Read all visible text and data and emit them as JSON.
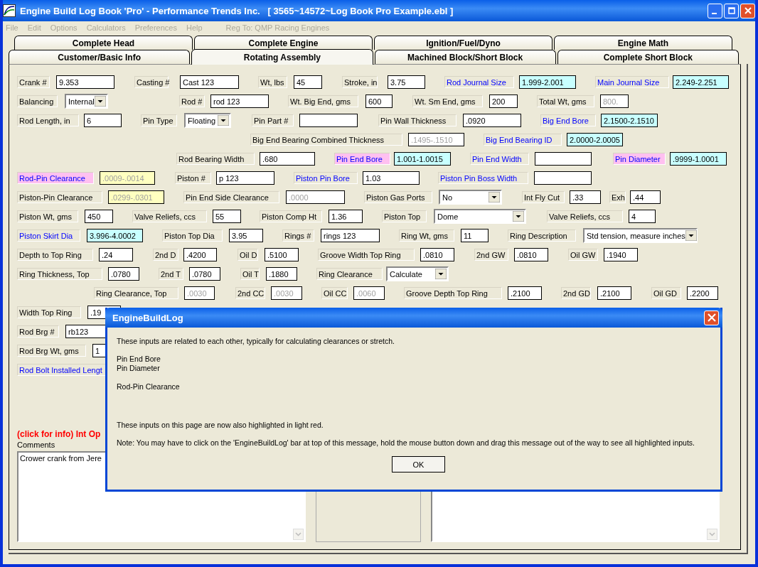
{
  "window": {
    "title": "Engine Build Log Book 'Pro' - Performance Trends Inc.   [ 3565~14572~Log Book Pro Example.ebl ]"
  },
  "menu": [
    {
      "label": "File",
      "disabled": true
    },
    {
      "label": "Edit",
      "disabled": true
    },
    {
      "label": "Options",
      "disabled": true
    },
    {
      "label": "Calculators",
      "disabled": true
    },
    {
      "label": "Preferences",
      "disabled": true
    },
    {
      "label": "Help",
      "disabled": true
    }
  ],
  "registration": "Reg To: QMP Racing Engines",
  "tabs_back": [
    {
      "label": "Complete Head",
      "selected": false
    },
    {
      "label": "Complete Engine",
      "selected": false
    },
    {
      "label": "Ignition/Fuel/Dyno",
      "selected": false
    },
    {
      "label": "Engine Math",
      "selected": false
    }
  ],
  "tabs_front": [
    {
      "label": "Customer/Basic Info",
      "selected": false
    },
    {
      "label": "Rotating Assembly",
      "selected": true
    },
    {
      "label": "Machined Block/Short Block",
      "selected": false
    },
    {
      "label": "Complete Short Block",
      "selected": false
    }
  ],
  "form_rows": [
    [
      {
        "label": {
          "text": "Crank #",
          "kind": "plain"
        },
        "field": {
          "value": "9.353",
          "kind": "text",
          "disabled": false
        }
      },
      {
        "label": {
          "text": "Casting #",
          "kind": "plain"
        },
        "field": {
          "value": "Cast 123",
          "kind": "text",
          "disabled": false
        }
      },
      {
        "label": {
          "text": "Wt, lbs",
          "kind": "plain"
        },
        "field": {
          "value": "45",
          "kind": "text",
          "disabled": false
        }
      },
      {
        "label": {
          "text": "Stroke, in",
          "kind": "plain"
        },
        "field": {
          "value": "3.75",
          "kind": "text",
          "disabled": false
        }
      },
      {
        "label": {
          "text": "Rod Journal Size",
          "kind": "linked"
        },
        "field": {
          "value": "1.999-2.001",
          "kind": "spec",
          "disabled": false
        }
      },
      {
        "label": {
          "text": "Main Journal Size",
          "kind": "linked"
        },
        "field": {
          "value": "2.249-2.251",
          "kind": "spec",
          "disabled": false
        }
      }
    ],
    [
      {
        "label": {
          "text": "Balancing",
          "kind": "plain"
        },
        "field": {
          "value": "Internal",
          "kind": "select"
        }
      },
      {
        "label": {
          "text": "Rod #",
          "kind": "plain"
        },
        "field": {
          "value": "rod 123",
          "kind": "text",
          "disabled": false
        }
      },
      {
        "label": {
          "text": "Wt. Big End, gms",
          "kind": "plain"
        },
        "field": {
          "value": "600",
          "kind": "text",
          "disabled": false
        }
      },
      {
        "label": {
          "text": "Wt. Sm End, gms",
          "kind": "plain"
        },
        "field": {
          "value": "200",
          "kind": "text",
          "disabled": false
        }
      },
      {
        "label": {
          "text": "Total Wt, gms",
          "kind": "plain"
        },
        "field": {
          "value": "800.",
          "kind": "text",
          "disabled": true
        }
      }
    ],
    [
      {
        "label": {
          "text": "Rod Length, in",
          "kind": "plain"
        },
        "field": {
          "value": "6",
          "kind": "text",
          "disabled": false
        }
      },
      {
        "label": {
          "text": "Pin Type",
          "kind": "plain"
        },
        "field": {
          "value": "Floating",
          "kind": "select"
        }
      },
      {
        "label": {
          "text": "Pin Part #",
          "kind": "plain"
        },
        "field": {
          "kind": "text"
        }
      },
      {
        "label": {
          "text": "Pin Wall Thickness",
          "kind": "plain"
        },
        "field": {
          "value": ".0920",
          "kind": "text",
          "disabled": false
        }
      },
      {
        "label": {
          "text": "Big End Bore",
          "kind": "linked"
        },
        "field": {
          "value": "2.1500-2.1510",
          "kind": "spec",
          "disabled": false
        }
      }
    ],
    [
      {
        "label": {
          "text": "Big End Bearing Combined Thickness",
          "kind": "plain"
        },
        "field": {
          "value": ".1495-.1510",
          "kind": "text",
          "disabled": true
        }
      },
      {
        "label": {
          "text": "Big End Bearing ID",
          "kind": "linked"
        },
        "field": {
          "value": "2.0000-2.0005",
          "kind": "spec",
          "disabled": false
        }
      }
    ],
    [
      {
        "label": {
          "text": "Rod Bearing Width",
          "kind": "plain"
        },
        "field": {
          "value": ".680",
          "kind": "text",
          "disabled": false
        }
      },
      {
        "label": {
          "text": "Pin End Bore",
          "kind": "highlighted"
        },
        "field": {
          "value": "1.001-1.0015",
          "kind": "spec",
          "disabled": false
        }
      },
      {
        "label": {
          "text": "Pin End Width",
          "kind": "linked"
        },
        "field": {
          "kind": "text"
        }
      },
      {
        "label": {
          "text": "Pin Diameter",
          "kind": "highlighted"
        },
        "field": {
          "value": ".9999-1.0001",
          "kind": "spec",
          "disabled": false
        }
      }
    ],
    [
      {
        "label": {
          "text": "Rod-Pin Clearance",
          "kind": "highlighted"
        },
        "field": {
          "value": ".0009-.0014",
          "kind": "calc",
          "disabled": true
        }
      },
      {
        "label": {
          "text": "Piston #",
          "kind": "plain"
        },
        "field": {
          "value": "p 123",
          "kind": "text",
          "disabled": false
        }
      },
      {
        "label": {
          "text": "Piston Pin Bore",
          "kind": "linked"
        },
        "field": {
          "value": "1.03",
          "kind": "text",
          "disabled": false
        }
      },
      {
        "label": {
          "text": "Piston Pin Boss Width",
          "kind": "linked"
        },
        "field": {
          "kind": "text"
        }
      }
    ],
    [
      {
        "label": {
          "text": "Piston-Pin Clearance",
          "kind": "plain"
        },
        "field": {
          "value": ".0299-.0301",
          "kind": "calc",
          "disabled": true
        }
      },
      {
        "label": {
          "text": "Pin End Side Clearance",
          "kind": "plain"
        },
        "field": {
          "value": ".0000",
          "kind": "text",
          "disabled": true
        }
      },
      {
        "label": {
          "text": "Piston Gas Ports",
          "kind": "plain"
        },
        "field": {
          "value": "No",
          "kind": "select"
        }
      },
      {
        "label": {
          "text": "Int Fly Cut",
          "kind": "plain"
        },
        "field": {
          "value": ".33",
          "kind": "text",
          "disabled": false
        }
      },
      {
        "label": {
          "text": "Exh",
          "kind": "plain"
        },
        "field": {
          "value": ".44",
          "kind": "text",
          "disabled": false
        }
      }
    ],
    [
      {
        "label": {
          "text": "Piston Wt, gms",
          "kind": "plain"
        },
        "field": {
          "value": "450",
          "kind": "text",
          "disabled": false
        }
      },
      {
        "label": {
          "text": "Valve Reliefs, ccs",
          "kind": "plain"
        },
        "field": {
          "value": "55",
          "kind": "text",
          "disabled": false
        }
      },
      {
        "label": {
          "text": "Piston Comp Ht",
          "kind": "plain"
        },
        "field": {
          "value": "1.36",
          "kind": "text",
          "disabled": false
        }
      },
      {
        "label": {
          "text": "Piston Top",
          "kind": "plain"
        },
        "field": {
          "value": "Dome",
          "kind": "select"
        }
      },
      {
        "label": {
          "text": "Valve Reliefs, ccs",
          "kind": "plain"
        },
        "field": {
          "value": "4",
          "kind": "text",
          "disabled": false
        }
      }
    ],
    [
      {
        "label": {
          "text": "Piston Skirt Dia",
          "kind": "linked"
        },
        "field": {
          "value": "3.996-4.0002",
          "kind": "spec",
          "disabled": false
        }
      },
      {
        "label": {
          "text": "Piston Top Dia",
          "kind": "plain"
        },
        "field": {
          "value": "3.95",
          "kind": "text",
          "disabled": false
        }
      },
      {
        "label": {
          "text": "Rings #",
          "kind": "plain"
        },
        "field": {
          "value": "rings 123",
          "kind": "text",
          "disabled": false
        }
      },
      {
        "label": {
          "text": "Ring Wt, gms",
          "kind": "plain"
        },
        "field": {
          "value": "11",
          "kind": "text",
          "disabled": false
        }
      },
      {
        "label": {
          "text": "Ring Description",
          "kind": "plain"
        },
        "field": {
          "value": "Std tension, measure inches",
          "kind": "select"
        }
      }
    ],
    [
      {
        "label": {
          "text": "Depth to Top Ring",
          "kind": "plain"
        },
        "field": {
          "value": ".24",
          "kind": "text",
          "disabled": false
        }
      },
      {
        "label": {
          "text": "2nd D",
          "kind": "plain"
        },
        "field": {
          "value": ".4200",
          "kind": "text",
          "disabled": false
        }
      },
      {
        "label": {
          "text": "Oil D",
          "kind": "plain"
        },
        "field": {
          "value": ".5100",
          "kind": "text",
          "disabled": false
        }
      },
      {
        "label": {
          "text": "Groove Width Top Ring",
          "kind": "plain"
        },
        "field": {
          "value": ".0810",
          "kind": "text",
          "disabled": false
        }
      },
      {
        "label": {
          "text": "2nd GW",
          "kind": "plain"
        },
        "field": {
          "value": ".0810",
          "kind": "text",
          "disabled": false
        }
      },
      {
        "label": {
          "text": "Oil GW",
          "kind": "plain"
        },
        "field": {
          "value": ".1940",
          "kind": "text",
          "disabled": false
        }
      }
    ],
    [
      {
        "label": {
          "text": "Ring Thickness, Top",
          "kind": "plain"
        },
        "field": {
          "value": ".0780",
          "kind": "text",
          "disabled": false
        }
      },
      {
        "label": {
          "text": "2nd T",
          "kind": "plain"
        },
        "field": {
          "value": ".0780",
          "kind": "text",
          "disabled": false
        }
      },
      {
        "label": {
          "text": "Oil T",
          "kind": "plain"
        },
        "field": {
          "value": ".1880",
          "kind": "text",
          "disabled": false
        }
      },
      {
        "label": {
          "text": "Ring Clearance",
          "kind": "plain"
        },
        "field": {
          "value": "Calculate",
          "kind": "select"
        }
      }
    ],
    [
      {
        "label": {
          "text": "Ring Clearance, Top",
          "kind": "plain"
        },
        "field": {
          "value": ".0030",
          "kind": "text",
          "disabled": true
        }
      },
      {
        "label": {
          "text": "2nd CC",
          "kind": "plain"
        },
        "field": {
          "value": ".0030",
          "kind": "text",
          "disabled": true
        }
      },
      {
        "label": {
          "text": "Oil CC",
          "kind": "plain"
        },
        "field": {
          "value": ".0060",
          "kind": "text",
          "disabled": true
        }
      },
      {
        "label": {
          "text": "Groove Depth Top Ring",
          "kind": "plain"
        },
        "field": {
          "value": ".2100",
          "kind": "text",
          "disabled": false
        }
      },
      {
        "label": {
          "text": "2nd GD",
          "kind": "plain"
        },
        "field": {
          "value": ".2100",
          "kind": "text",
          "disabled": false
        }
      },
      {
        "label": {
          "text": "Oil GD",
          "kind": "plain"
        },
        "field": {
          "value": ".2200",
          "kind": "text",
          "disabled": false
        }
      }
    ],
    [
      {
        "label": {
          "text": "Width Top Ring",
          "kind": "plain"
        },
        "field": {
          "value": ".19",
          "kind": "text",
          "disabled": false
        }
      }
    ],
    [
      {
        "label": {
          "text": "Rod Brg #",
          "kind": "plain"
        },
        "field": {
          "value": "rb123",
          "kind": "text",
          "disabled": false
        }
      }
    ],
    [
      {
        "label": {
          "text": "Rod Brg Wt, gms",
          "kind": "plain"
        },
        "field": {
          "value": "1",
          "kind": "text",
          "disabled": false
        }
      }
    ],
    [
      {
        "label": {
          "text": "Rod Bolt Installed Lengt",
          "kind": "linked"
        }
      }
    ]
  ],
  "info_link": "(click for info) Int Op",
  "comments": {
    "label": "Comments",
    "value": "Crower crank from Jere"
  },
  "dialog": {
    "title": "EngineBuildLog",
    "message": "These inputs are related to each other, typically for calculating clearances or stretch.",
    "related": [
      "Pin End Bore",
      "Pin Diameter"
    ],
    "result": "Rod-Pin Clearance",
    "highlight_note": "These inputs on this page are now also highlighted in light red.",
    "note": "Note:  You may have to click on the 'EngineBuildLog' bar at top of this message, hold the mouse button down and drag this message out of the way to see all highlighted inputs.",
    "button": "OK"
  }
}
